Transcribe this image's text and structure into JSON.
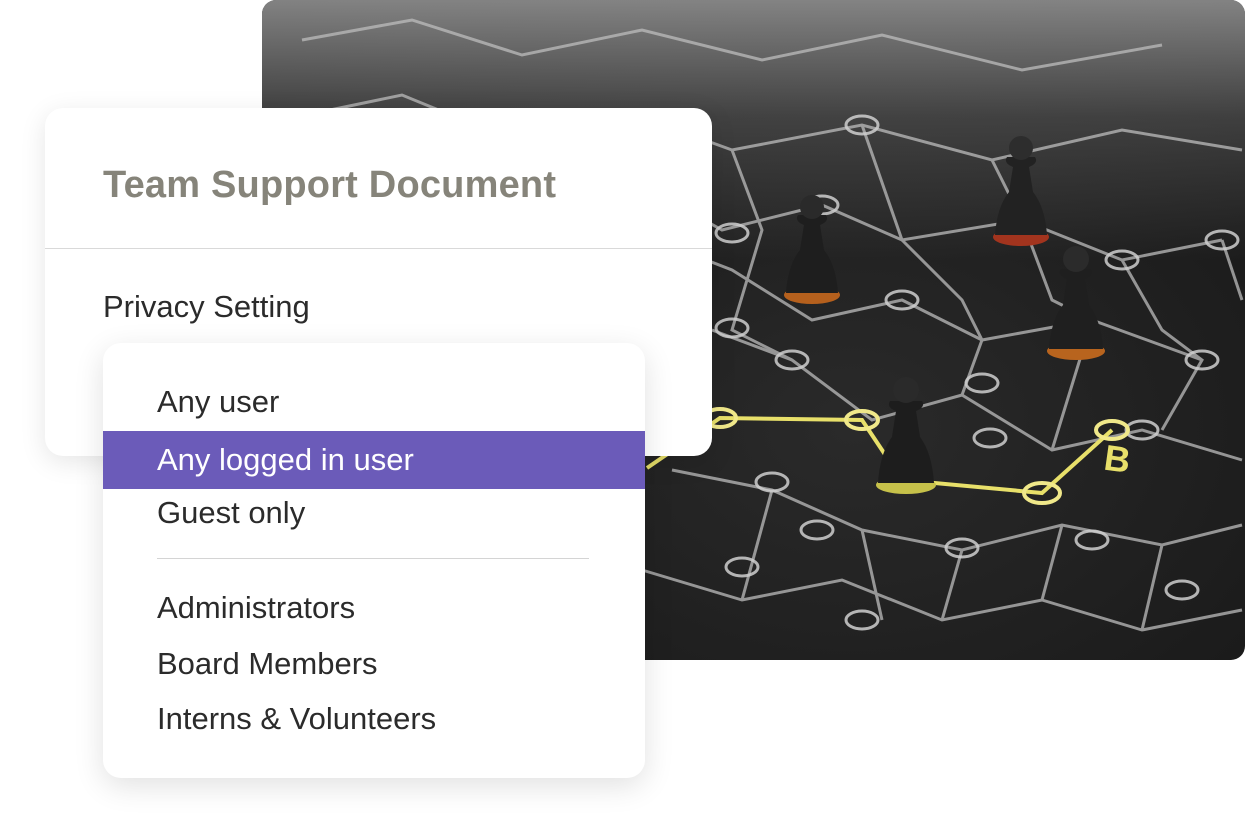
{
  "document": {
    "title": "Team Support Document",
    "privacy_label": "Privacy Setting"
  },
  "menu": {
    "groups": [
      {
        "items": [
          {
            "label": "Any user",
            "selected": false
          },
          {
            "label": "Any logged in user",
            "selected": true
          },
          {
            "label": "Guest only",
            "selected": false
          }
        ]
      },
      {
        "items": [
          {
            "label": "Administrators",
            "selected": false
          },
          {
            "label": "Board Members",
            "selected": false
          },
          {
            "label": "Interns & Volunteers",
            "selected": false
          }
        ]
      }
    ]
  },
  "photo": {
    "subject": "network-graph-with-pawns",
    "marker_label": "B"
  },
  "colors": {
    "selected_bg": "#6b5bb9",
    "selected_text": "#ffffff",
    "title_text": "#86847a",
    "path_highlight": "#e8e06a"
  }
}
